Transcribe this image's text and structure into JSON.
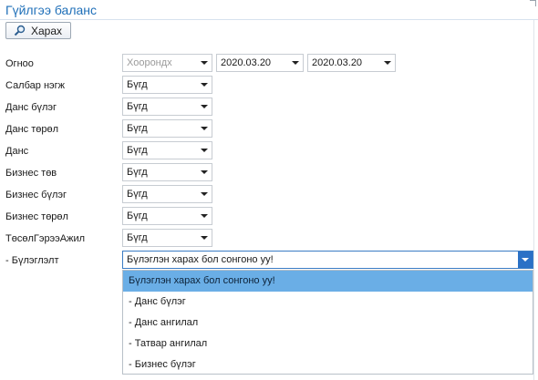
{
  "header": {
    "title": "Гүйлгээ баланс",
    "search_button_label": "Харах"
  },
  "form": {
    "date": {
      "label": "Огноо",
      "mode_value": "Хоорондх",
      "start_date": "2020.03.20",
      "end_date": "2020.03.20"
    },
    "filters": [
      {
        "label": "Салбар нэгж",
        "value": "Бүгд"
      },
      {
        "label": "Данс бүлэг",
        "value": "Бүгд"
      },
      {
        "label": "Данс төрөл",
        "value": "Бүгд"
      },
      {
        "label": "Данс",
        "value": "Бүгд"
      },
      {
        "label": "Бизнес төв",
        "value": "Бүгд"
      },
      {
        "label": "Бизнес бүлэг",
        "value": "Бүгд"
      },
      {
        "label": "Бизнес төрөл",
        "value": "Бүгд"
      },
      {
        "label": "ТөсөлГэрээАжил",
        "value": "Бүгд"
      }
    ],
    "grouping": {
      "label": "- Бүлэглэлт",
      "value": "Бүлэглэн харах бол сонгоно уу!",
      "options": [
        "Бүлэглэн харах бол сонгоно уу!",
        "- Данс бүлэг",
        "- Данс ангилал",
        "- Татвар ангилал",
        "- Бизнес бүлэг"
      ]
    }
  },
  "colors": {
    "title": "#1e6fb8",
    "dropdown_selected": "#6aaee6",
    "active_arrow": "#2b71c6"
  }
}
